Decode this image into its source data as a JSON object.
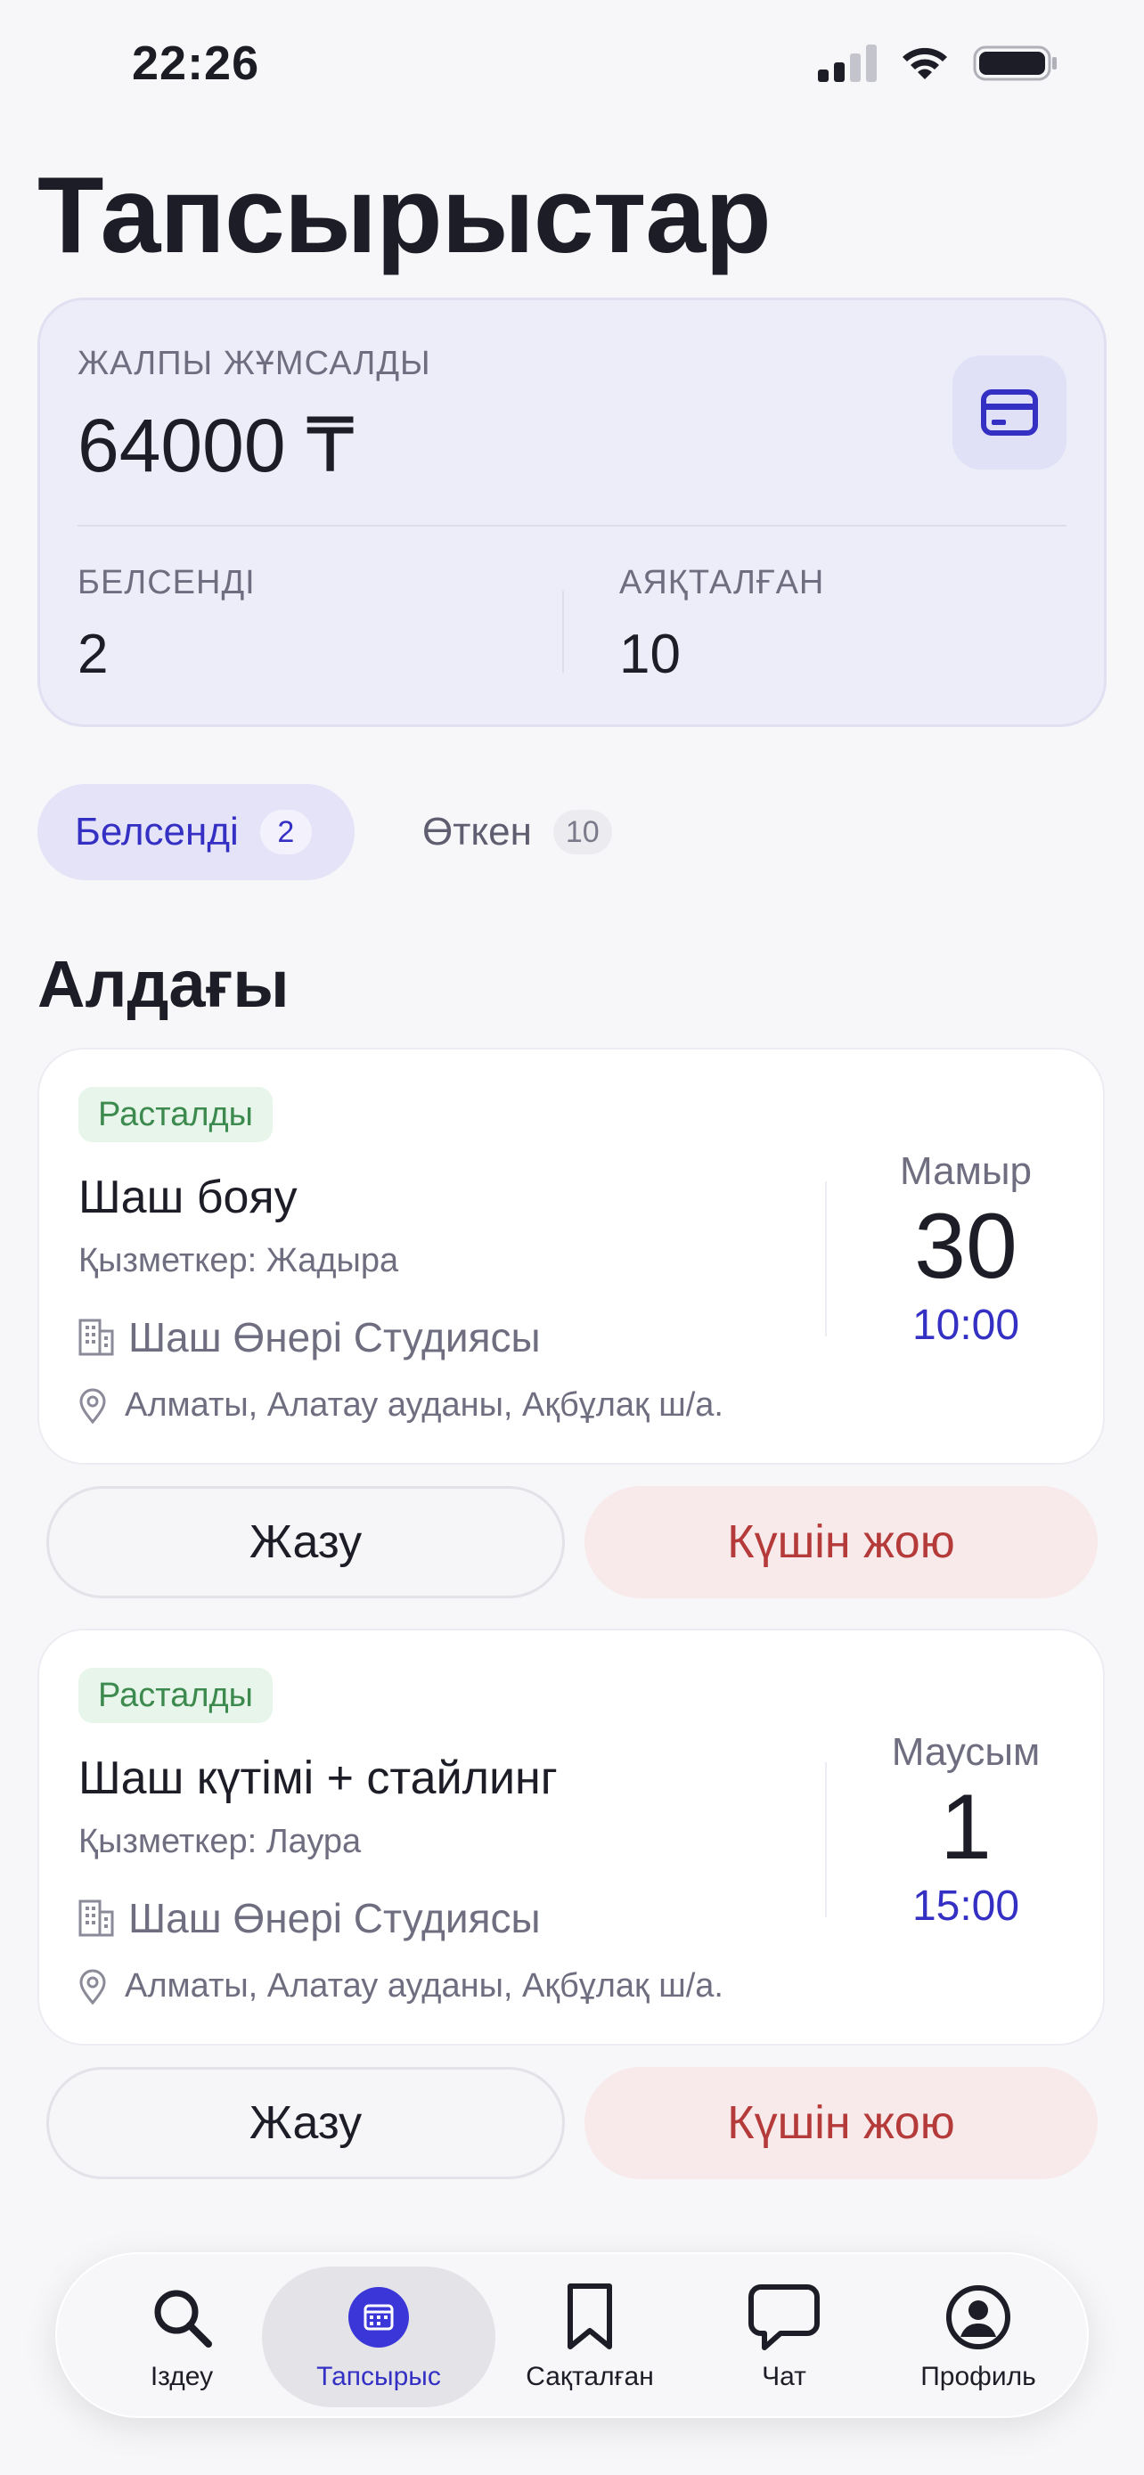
{
  "status": {
    "time": "22:26"
  },
  "page_title": "Тапсырыстар",
  "summary": {
    "spent_label": "ЖАЛПЫ ЖҰМСАЛДЫ",
    "spent_value": "64000 ₸",
    "active_label": "БЕЛСЕНДІ",
    "active_value": "2",
    "done_label": "АЯҚТАЛҒАН",
    "done_value": "10"
  },
  "tabs": [
    {
      "label": "Белсенді",
      "count": "2",
      "active": true
    },
    {
      "label": "Өткен",
      "count": "10",
      "active": false
    }
  ],
  "section_title": "Алдағы",
  "appointments": [
    {
      "status": "Расталды",
      "service": "Шаш бояу",
      "staff": "Қызметкер: Жадыра",
      "place": "Шаш Өнері Студиясы",
      "address": "Алматы, Алатау ауданы, Ақбұлақ ш/а.",
      "month": "Мамыр",
      "day": "30",
      "time": "10:00",
      "write_label": "Жазу",
      "cancel_label": "Күшін жою"
    },
    {
      "status": "Расталды",
      "service": "Шаш күтімі + стайлинг",
      "staff": "Қызметкер: Лаура",
      "place": "Шаш Өнері Студиясы",
      "address": "Алматы, Алатау ауданы, Ақбұлақ ш/а.",
      "month": "Маусым",
      "day": "1",
      "time": "15:00",
      "write_label": "Жазу",
      "cancel_label": "Күшін жою"
    }
  ],
  "nav": [
    {
      "label": "Іздеу",
      "icon": "search-icon"
    },
    {
      "label": "Тапсырыс",
      "icon": "calendar-icon",
      "active": true
    },
    {
      "label": "Сақталған",
      "icon": "bookmark-icon"
    },
    {
      "label": "Чат",
      "icon": "chat-icon"
    },
    {
      "label": "Профиль",
      "icon": "profile-icon"
    }
  ],
  "colors": {
    "accent": "#3530c4",
    "cancel": "#b53a3a",
    "confirmed": "#3d8a4f"
  }
}
